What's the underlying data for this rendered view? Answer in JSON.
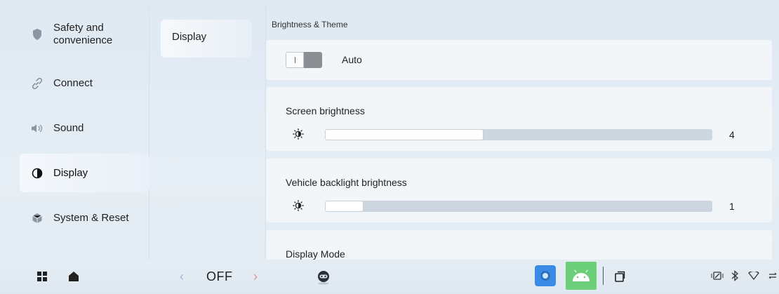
{
  "nav": {
    "items": [
      {
        "label_line1": "Safety and",
        "label_line2": "convenience",
        "icon": "shield-icon"
      },
      {
        "label": "Connect",
        "icon": "link-icon"
      },
      {
        "label": "Sound",
        "icon": "speaker-icon"
      },
      {
        "label": "Display",
        "icon": "contrast-icon",
        "active": true
      },
      {
        "label": "System & Reset",
        "icon": "cube-icon"
      }
    ]
  },
  "subnav": {
    "items": [
      {
        "label": "Display",
        "active": true
      }
    ]
  },
  "content": {
    "section_title": "Brightness & Theme",
    "auto": {
      "label": "Auto",
      "toggle_on": false
    },
    "screen_brightness": {
      "title": "Screen brightness",
      "value": "4",
      "level": 0.41
    },
    "vehicle_backlight": {
      "title": "Vehicle backlight brightness",
      "value": "1",
      "level": 0.1
    },
    "display_mode": {
      "title": "Display Mode"
    }
  },
  "taskbar": {
    "climate_value": "OFF",
    "icons": [
      "apps-grid-icon",
      "home-icon",
      "chevron-left-icon",
      "chevron-right-icon",
      "assistant-robot-icon",
      "settings-app-icon",
      "android-app-icon",
      "recent-apps-icon",
      "network-icon",
      "bluetooth-icon",
      "wifi-icon",
      "more-icon"
    ]
  },
  "colors": {
    "accent_left_chevron": "#9fb4d8",
    "accent_right_chevron": "#e08a9a",
    "android_green": "#6cd07a",
    "settings_blue": "#3a8be6"
  }
}
